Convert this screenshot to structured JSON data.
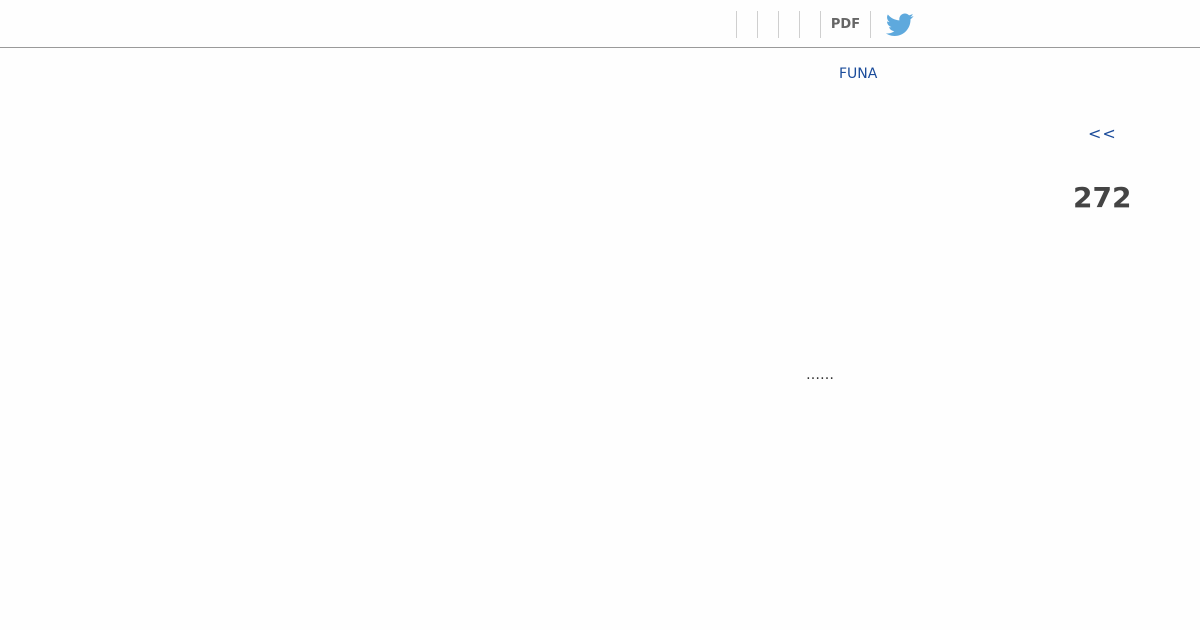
{
  "toolbar": {
    "pdf_label": "PDF",
    "twitter_icon": "twitter-bird-icon",
    "twitter_color": "#5ea9dd"
  },
  "content": {
    "funa_link": "FUNA",
    "back_link": "<<",
    "page_number": "272",
    "ellipsis": "……"
  },
  "colors": {
    "link": "#1a4b9a",
    "page_number": "#444444",
    "divider": "#9a9a9a"
  }
}
